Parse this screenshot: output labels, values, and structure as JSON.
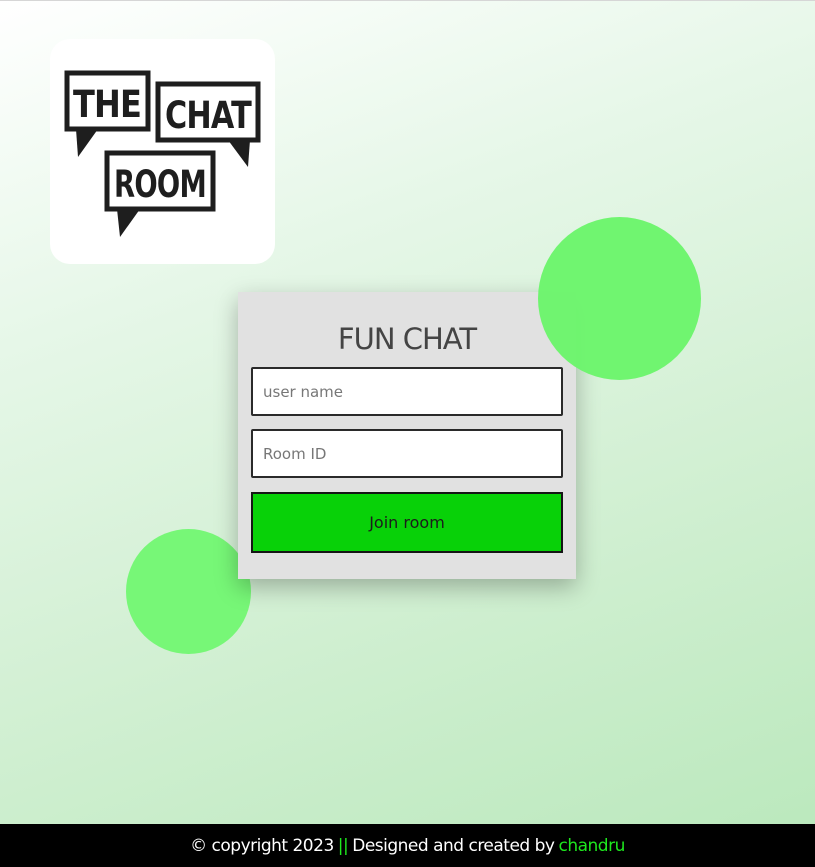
{
  "logo": {
    "words": [
      "THE",
      "CHAT",
      "ROOM"
    ]
  },
  "login_card": {
    "title": "FUN CHAT",
    "username_placeholder": "user name",
    "username_value": "",
    "roomid_placeholder": "Room ID",
    "roomid_value": "",
    "join_label": "Join room"
  },
  "footer": {
    "copyright": "© copyright 2023",
    "separator": "||",
    "credit": "Designed and created by",
    "author": "chandru"
  },
  "colors": {
    "accent_green": "#08d108",
    "circle_green": "#6cf56c",
    "footer_link_green": "#1ee81e",
    "footer_bg": "#000000",
    "card_bg": "#e1e1e1"
  }
}
